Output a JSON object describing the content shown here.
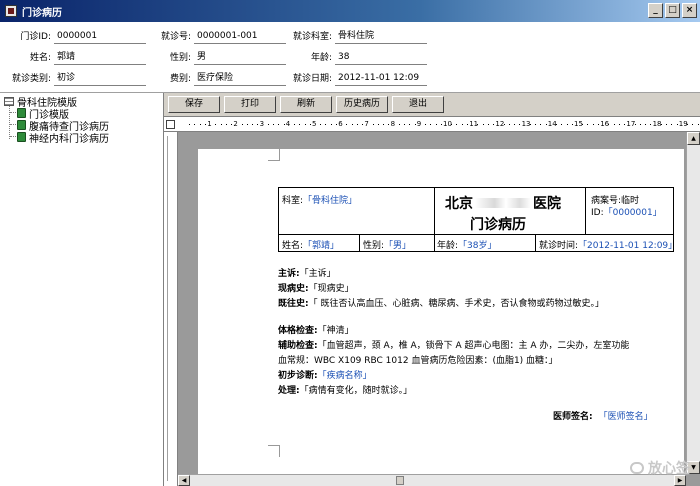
{
  "window": {
    "title": "门诊病历"
  },
  "info": {
    "outpatient_id_label": "门诊ID:",
    "outpatient_id": "0000001",
    "visit_no_label": "就诊号:",
    "visit_no": "0000001-001",
    "dept_label": "就诊科室:",
    "dept": "骨科住院",
    "name_label": "姓名:",
    "name": "郭靖",
    "gender_label": "性别:",
    "gender": "男",
    "age_label": "年龄:",
    "age": "38",
    "visit_type_label": "就诊类别:",
    "visit_type": "初诊",
    "fee_label": "费别:",
    "fee": "医疗保险",
    "date_label": "就诊日期:",
    "date": "2012-11-01 12:09"
  },
  "tree": {
    "root": "骨科住院模版",
    "items": [
      "门诊模版",
      "腹痛待查门诊病历",
      "神经内科门诊病历"
    ]
  },
  "toolbar": {
    "save": "保存",
    "print": "打印",
    "refresh": "刷新",
    "history": "历史病历",
    "exit": "退出"
  },
  "ruler": {
    "numbers": [
      "1",
      "2",
      "3",
      "4",
      "5",
      "6",
      "7",
      "8",
      "9",
      "10",
      "11",
      "12",
      "13",
      "14",
      "15",
      "16",
      "17",
      "18",
      "19"
    ]
  },
  "doc": {
    "dept_label": "科室:",
    "dept_value": "「骨科住院」",
    "hospital_a": "北京",
    "hospital_b": "医院",
    "record_title": "门诊病历",
    "case_no_label": "病案号:",
    "case_no_value": "临时",
    "id_label": "ID:",
    "id_value": "「0000001」",
    "name_label": "姓名:",
    "name_value": "「郭靖」",
    "gender_label": "性别:",
    "gender_value": "「男」",
    "age_label": "年龄:",
    "age_value": "「38岁」",
    "time_label": "就诊时间:",
    "time_value": "「2012-11-01 12:09」",
    "complaint_label": "主诉:",
    "complaint_value": "「主诉」",
    "present_label": "现病史:",
    "present_value": "「现病史」",
    "past_label": "既往史:",
    "past_value": "「 既往否认高血压、心脏病、糖尿病、手术史，否认食物或药物过敏史。」",
    "exam_label": "体格检查:",
    "exam_value": "「神清」",
    "aux_label": "辅助检查:",
    "aux_value_1": "「血管超声，颈 A，椎 A，锁骨下 A   超声心电图：主 A 办，二尖办，左室功能",
    "aux_value_2": "血常规：WBC  X109   RBC   1012  血管病历危险因素：(血脂1) 血糖：」",
    "dx_label": "初步诊断:",
    "dx_value": "「疾病名称」",
    "plan_label": "处理:",
    "plan_value": "「病情有变化，随时就诊。」",
    "doctor_label": "医师签名:",
    "doctor_value": "「医师签名」"
  },
  "watermark": "放心签"
}
